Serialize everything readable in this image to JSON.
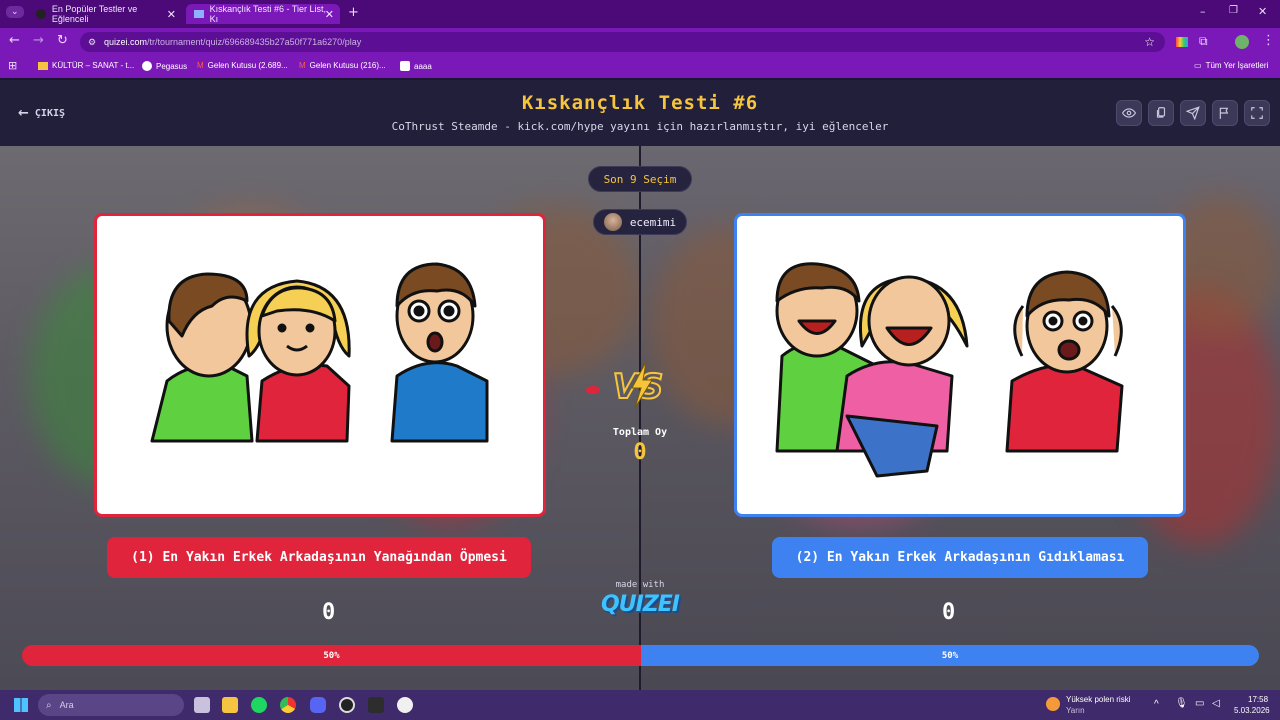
{
  "browser": {
    "tabs": [
      {
        "title": "En Popüler Testler ve Eğlenceli "
      },
      {
        "title": "Kıskançlık Testi #6 - Tier List, Kı"
      }
    ],
    "url_domain": "quizei.com",
    "url_path": "/tr/tournament/quiz/696689435b27a50f771a6270/play",
    "bookmarks": [
      "KÜLTÜR – SANAT - t...",
      "Pegasus",
      "Gelen Kutusu (2.689...",
      "Gelen Kutusu (216)...",
      "aaaa"
    ],
    "all_bookmarks": "Tüm Yer İşaretleri"
  },
  "header": {
    "exit_label": "ÇIKIŞ",
    "title": "Kıskançlık Testi #6",
    "subtitle": "CoThrust Steamde - kick.com/hype yayını için hazırlanmıştır, iyi eğlenceler"
  },
  "round": {
    "label": "Son 9 Seçim",
    "user": "ecemimi"
  },
  "left": {
    "label": "(1) En Yakın Erkek Arkadaşının Yanağından Öpmesi",
    "votes": "0",
    "percent_label": "50%",
    "percent": 50
  },
  "right": {
    "label": "(2) En Yakın Erkek Arkadaşının Gıdıklaması",
    "votes": "0",
    "percent_label": "50%",
    "percent": 50
  },
  "center": {
    "total_label": "Toplam Oy",
    "total_value": "0",
    "made_with": "made with",
    "brand": "QUIZEI"
  },
  "taskbar": {
    "search_placeholder": "Ara",
    "weather_title": "Yüksek polen riski",
    "weather_sub": "Yarın",
    "time": "17:58",
    "date": "5.03.2026"
  },
  "colors": {
    "red": "#e0243c",
    "blue": "#3d82f0",
    "gold": "#f6c53b"
  }
}
